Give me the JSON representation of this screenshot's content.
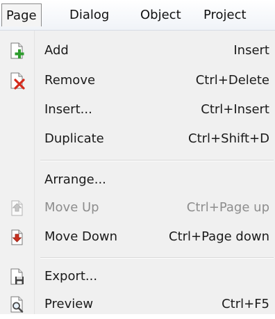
{
  "menubar": {
    "items": [
      {
        "label": "Page"
      },
      {
        "label": "Dialog"
      },
      {
        "label": "Object"
      },
      {
        "label": "Project"
      }
    ]
  },
  "page_menu": {
    "items": [
      {
        "label": "Add",
        "shortcut": "Insert",
        "icon": "page-add-icon",
        "enabled": true
      },
      {
        "label": "Remove",
        "shortcut": "Ctrl+Delete",
        "icon": "page-remove-icon",
        "enabled": true
      },
      {
        "label": "Insert...",
        "shortcut": "Ctrl+Insert",
        "icon": "",
        "enabled": true
      },
      {
        "label": "Duplicate",
        "shortcut": "Ctrl+Shift+D",
        "icon": "",
        "enabled": true
      },
      {
        "label": "Arrange...",
        "shortcut": "",
        "icon": "",
        "enabled": true
      },
      {
        "label": "Move Up",
        "shortcut": "Ctrl+Page up",
        "icon": "move-up-icon",
        "enabled": false
      },
      {
        "label": "Move Down",
        "shortcut": "Ctrl+Page down",
        "icon": "move-down-icon",
        "enabled": true
      },
      {
        "label": "Export...",
        "shortcut": "",
        "icon": "page-export-icon",
        "enabled": true
      },
      {
        "label": "Preview",
        "shortcut": "Ctrl+F5",
        "icon": "page-preview-icon",
        "enabled": true
      }
    ]
  },
  "colors": {
    "add_green": "#2e9b2e",
    "remove_red": "#d42a1c",
    "move_down_red": "#c9301f",
    "disabled_gray": "#8d8d8d"
  }
}
